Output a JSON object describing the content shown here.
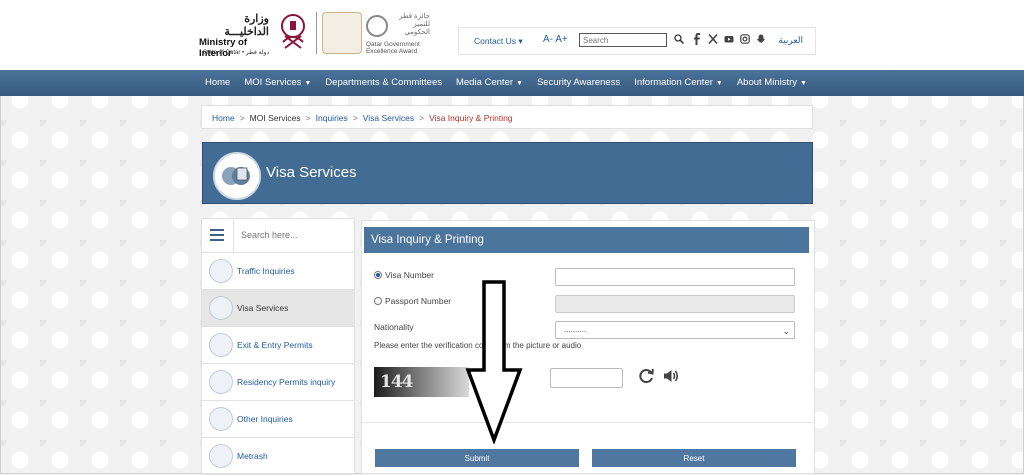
{
  "header": {
    "logo_ar": "وزارة الداخليـــة",
    "logo_en": "Ministry of Interior",
    "logo_sub": "State of Qatar • دولة قطر",
    "award_ar": "جائزة قطر للتميز الحكومي",
    "award_en": "Qatar Government Excellence Award",
    "contact_label": "Contact Us",
    "text_size": "A- A+",
    "search_placeholder": "Search",
    "language": "العربية",
    "social_icons": [
      "facebook-icon",
      "x-icon",
      "youtube-icon",
      "instagram-icon",
      "snapchat-icon"
    ]
  },
  "nav": {
    "items": [
      {
        "label": "Home",
        "caret": false
      },
      {
        "label": "MOI Services",
        "caret": true
      },
      {
        "label": "Departments & Committees",
        "caret": false
      },
      {
        "label": "Media Center",
        "caret": true
      },
      {
        "label": "Security Awareness",
        "caret": false
      },
      {
        "label": "Information Center",
        "caret": true
      },
      {
        "label": "About Ministry",
        "caret": true
      }
    ]
  },
  "breadcrumb": {
    "home": "Home",
    "moi_services": "MOI Services",
    "inquiries": "Inquiries",
    "visa_services": "Visa Services",
    "current": "Visa Inquiry & Printing"
  },
  "banner": {
    "title": "Visa Services"
  },
  "sidebar": {
    "search_placeholder": "Search here...",
    "items": [
      {
        "label": "Traffic Inquiries",
        "active": false
      },
      {
        "label": "Visa Services",
        "active": true
      },
      {
        "label": "Exit & Entry Permits",
        "active": false
      },
      {
        "label": "Residency Permits inquiry",
        "active": false
      },
      {
        "label": "Other Inquiries",
        "active": false
      },
      {
        "label": "Metrash",
        "active": false
      }
    ]
  },
  "form": {
    "title": "Visa Inquiry & Printing",
    "visa_number_label": "Visa Number",
    "passport_number_label": "Passport Number",
    "nationality_label": "Nationality",
    "nationality_value": "..........",
    "verification_note": "Please enter the verification code from the picture or audio",
    "captcha_text": "144",
    "submit_label": "Submit",
    "reset_label": "Reset",
    "selected_option": "visa_number"
  },
  "colors": {
    "nav_bg": "#3c6185",
    "banner_bg": "#436c94",
    "panel_head": "#4c759e",
    "link": "#1f5a9e",
    "breadcrumb_current": "#b0302a"
  }
}
